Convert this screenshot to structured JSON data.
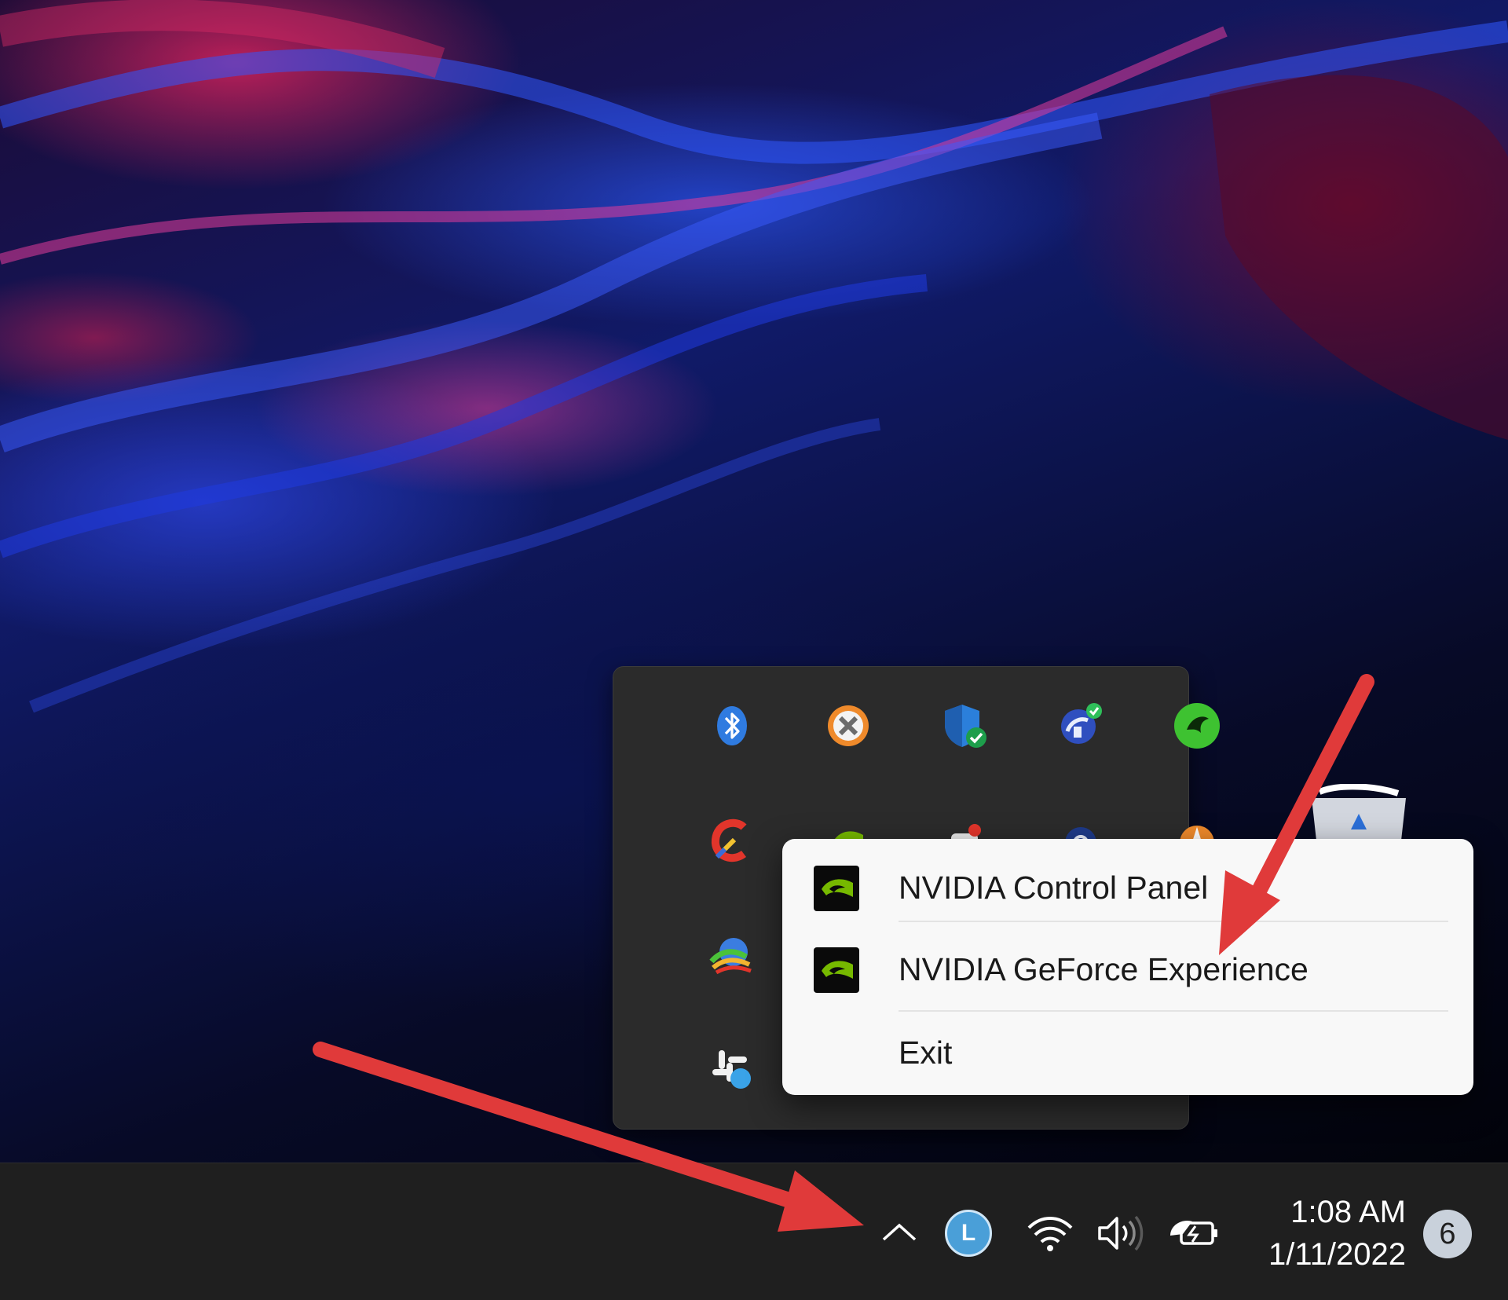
{
  "context_menu": {
    "items": [
      {
        "label": "NVIDIA Control Panel",
        "icon": "nvidia-icon"
      },
      {
        "label": "NVIDIA GeForce Experience",
        "icon": "nvidia-icon"
      },
      {
        "label": "Exit"
      }
    ]
  },
  "taskbar": {
    "clock_time": "1:08 AM",
    "clock_date": "1/11/2022",
    "notification_count": "6",
    "account_initial": "L"
  },
  "colors": {
    "annotation_arrow": "#e03a3a",
    "nvidia_green": "#76b900",
    "panel_background": "#2b2b2b",
    "menu_background": "#f8f8f8",
    "taskbar_background": "#1f1f1f"
  }
}
